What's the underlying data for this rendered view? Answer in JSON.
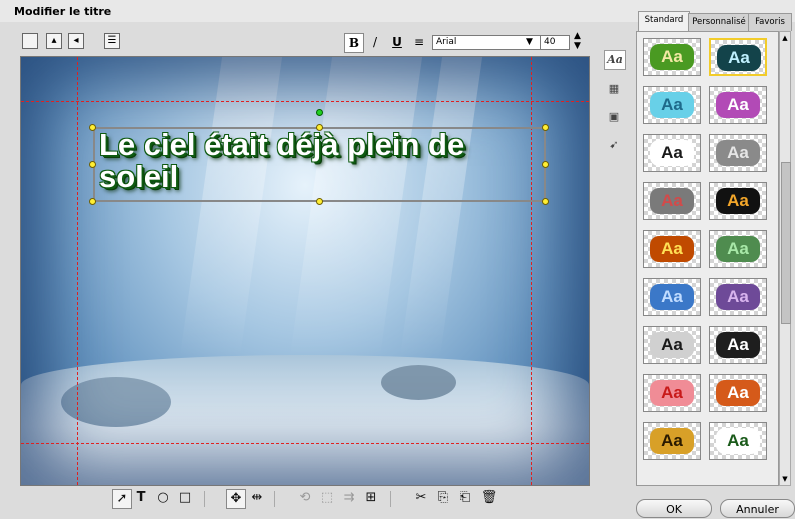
{
  "window": {
    "title": "Modifier le titre"
  },
  "toolbar": {
    "bold_label": "B",
    "italic_label": "/",
    "underline_label": "U",
    "align_label": "≡",
    "font": "Arial",
    "size": "40"
  },
  "canvas": {
    "title_line1": "Le ciel était déjà plein de",
    "title_line2": "soleil"
  },
  "side_tools": [
    "Aa",
    "▦",
    "▣",
    "➹"
  ],
  "panel": {
    "tabs": [
      "Standard",
      "Personnalisé",
      "Favoris"
    ],
    "swatch_text": "Aa",
    "styles": [
      {
        "fg": "#f3e9a4",
        "bg": "#4a9a22",
        "selected": false
      },
      {
        "fg": "#bff0ff",
        "bg": "#13434a",
        "selected": true
      },
      {
        "fg": "#1e6a8a",
        "bg": "#68d0e8",
        "selected": false
      },
      {
        "fg": "#ffffff",
        "bg": "#b24ab6",
        "selected": false
      },
      {
        "fg": "#1a1a1a",
        "bg": "#ffffff",
        "selected": false
      },
      {
        "fg": "#e6e6e6",
        "bg": "#8a8a8a",
        "selected": false
      },
      {
        "fg": "#d24a4a",
        "bg": "#7a7a7a",
        "selected": false
      },
      {
        "fg": "#f4a72a",
        "bg": "#111111",
        "selected": false
      },
      {
        "fg": "#ffe055",
        "bg": "#c04a00",
        "selected": false
      },
      {
        "fg": "#a8e8a8",
        "bg": "#4f8c4f",
        "selected": false
      },
      {
        "fg": "#c0dcff",
        "bg": "#3b78c8",
        "selected": false
      },
      {
        "fg": "#d8b4ee",
        "bg": "#6e4a98",
        "selected": false
      },
      {
        "fg": "#1a1a1a",
        "bg": "#d0d0d0",
        "selected": false
      },
      {
        "fg": "#ffffff",
        "bg": "#1e1e1e",
        "selected": false
      },
      {
        "fg": "#c81a1a",
        "bg": "#f08c96",
        "selected": false
      },
      {
        "fg": "#ffffff",
        "bg": "#d55a1a",
        "selected": false
      },
      {
        "fg": "#2a1a00",
        "bg": "#d8a028",
        "selected": false
      },
      {
        "fg": "#1a5a1a",
        "bg": "#ffffff",
        "selected": false
      }
    ]
  },
  "bottom_tools": [
    "➚",
    "T",
    "○",
    "□",
    "✥",
    "⇹",
    "⟲",
    "⬚",
    "⇉",
    "⊞",
    "✂",
    "⎘",
    "⎗",
    "🗑"
  ],
  "buttons": {
    "ok": "OK",
    "cancel": "Annuler"
  }
}
